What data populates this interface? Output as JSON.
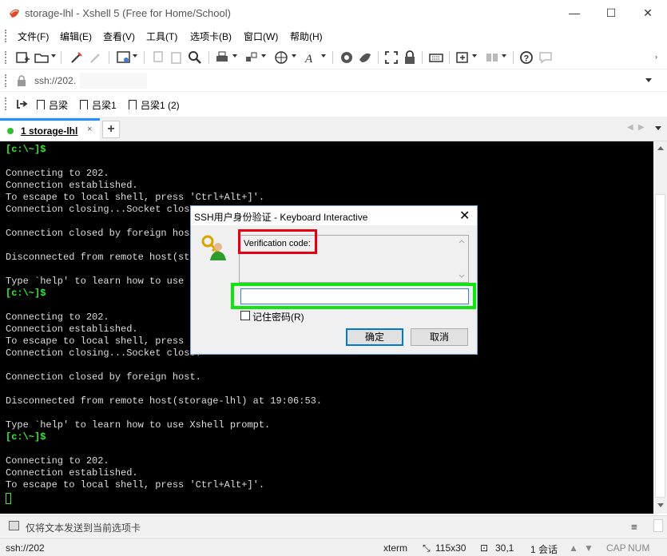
{
  "window": {
    "title": "storage-lhl - Xshell 5 (Free for Home/School)",
    "controls": {
      "minimize": "—",
      "maximize": "☐",
      "close": "✕"
    }
  },
  "menu": [
    "文件(F)",
    "编辑(E)",
    "查看(V)",
    "工具(T)",
    "选项卡(B)",
    "窗口(W)",
    "帮助(H)"
  ],
  "address": {
    "value": "ssh://202."
  },
  "links": [
    "吕梁",
    "吕梁1",
    "吕梁1 (2)"
  ],
  "tab": {
    "label": "1 storage-lhl",
    "close": "×",
    "add": "+"
  },
  "terminal": {
    "lines": [
      "[c:\\~]$",
      "",
      "Connecting to 202.",
      "Connection established.",
      "To escape to local shell, press 'Ctrl+Alt+]'.",
      "Connection closing...Socket close.",
      "",
      "Connection closed by foreign host.",
      "",
      "Disconnected from remote host(sto",
      "",
      "Type `help' to learn how to use X",
      "[c:\\~]$",
      "",
      "Connecting to 202.",
      "Connection established.",
      "To escape to local shell, press 'Ctrl+Alt+]'.",
      "Connection closing...Socket close.",
      "",
      "Connection closed by foreign host.",
      "",
      "Disconnected from remote host(storage-lhl) at 19:06:53.",
      "",
      "Type `help' to learn how to use Xshell prompt.",
      "[c:\\~]$",
      "",
      "Connecting to 202.",
      "Connection established.",
      "To escape to local shell, press 'Ctrl+Alt+]'."
    ]
  },
  "dialog": {
    "title": "SSH用户身份验证 - Keyboard Interactive",
    "close": "✕",
    "prompt": "Verification code:",
    "input_value": "",
    "remember_label": "记住密码(R)",
    "ok_label": "确定",
    "cancel_label": "取消"
  },
  "send_bar": {
    "text": "仅将文本发送到当前选项卡",
    "menu": "≡"
  },
  "status": {
    "connection": "ssh://202",
    "terminal_type": "xterm",
    "size": "115x30",
    "cursor_pos": "30,1",
    "sessions": "1 会话",
    "caps": "CAP",
    "num": "NUM"
  }
}
